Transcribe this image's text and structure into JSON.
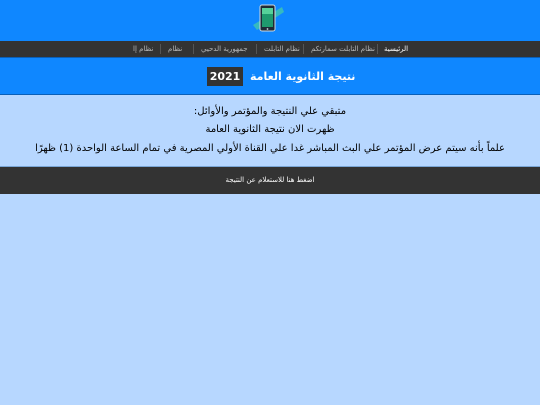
{
  "header": {
    "logo_icon": "tablet-logo-icon"
  },
  "nav": {
    "items": [
      {
        "label": "الرئيسية",
        "active": true
      },
      {
        "label": "نظام التابلت سمارتكم",
        "active": false
      },
      {
        "label": "نظام التابلت",
        "active": false
      },
      {
        "label": "جمهورية الدحيي",
        "active": false
      },
      {
        "label": "نظام",
        "active": false
      },
      {
        "label": "نظام إا",
        "active": false
      }
    ]
  },
  "title_bar": {
    "title": "نتيجة الثانوية العامة",
    "year": "2021"
  },
  "content": {
    "lines": [
      "متبقي علي النتيجة والمؤتمر والأوائل:",
      "ظهرت الان نتيجة الثانوية العامة",
      "علماً بأنه سيتم عرض المؤتمر علي البث المباشر غدا علي القناة الأولي المصرية في تمام الساعة الواحدة (1) ظهرًا"
    ]
  },
  "cta": {
    "label": "اضغط هنا للاستعلام عن النتيجة"
  },
  "colors": {
    "primary_blue": "#0f87ff",
    "dark": "#333333",
    "light_blue_bg": "#b7d7ff"
  }
}
